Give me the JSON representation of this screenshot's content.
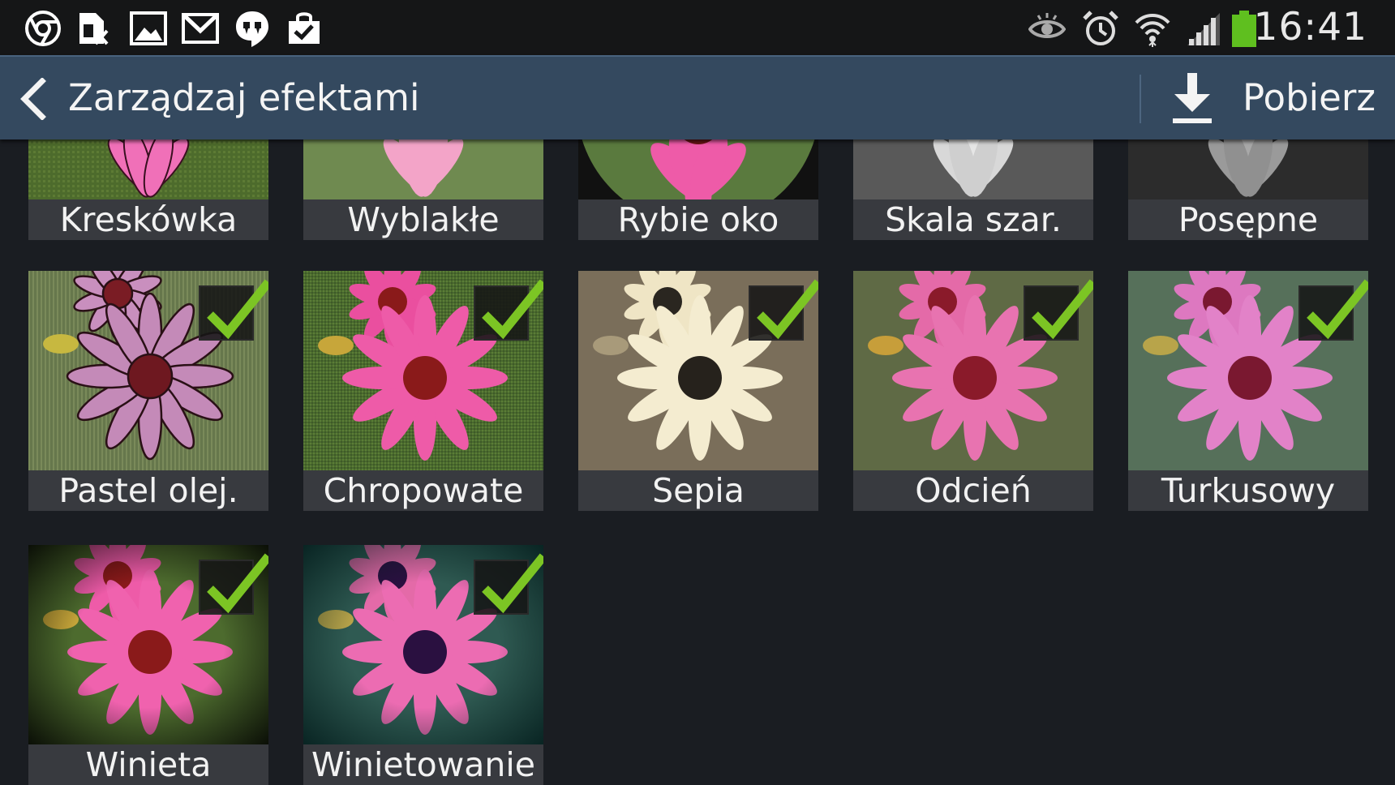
{
  "status_bar": {
    "time": "16:41",
    "left_icons": [
      "chrome-icon",
      "sim-card-icon",
      "gallery-icon",
      "gmail-icon",
      "hangouts-icon",
      "shopping-bag-icon"
    ],
    "right_icons": [
      "smart-stay-eye-icon",
      "alarm-icon",
      "wifi-icon",
      "signal-icon",
      "battery-icon"
    ],
    "battery_color": "#5fbf1f"
  },
  "action_bar": {
    "title": "Zarządzaj efektami",
    "download_label": "Pobierz",
    "background": "#34495f"
  },
  "effects": [
    {
      "label": "Kreskówka",
      "checked": false
    },
    {
      "label": "Wyblakłe",
      "checked": false
    },
    {
      "label": "Rybie oko",
      "checked": false
    },
    {
      "label": "Skala szar.",
      "checked": false
    },
    {
      "label": "Posępne",
      "checked": false
    },
    {
      "label": "Pastel olej.",
      "checked": true
    },
    {
      "label": "Chropowate",
      "checked": true
    },
    {
      "label": "Sepia",
      "checked": true
    },
    {
      "label": "Odcień",
      "checked": true
    },
    {
      "label": "Turkusowy",
      "checked": true
    },
    {
      "label": "Winieta",
      "checked": true
    },
    {
      "label": "Winietowanie",
      "checked": true
    }
  ],
  "colors": {
    "check_green": "#7cc524",
    "flower_pink": "#ee5ba8",
    "flower_center": "#8a1a1a"
  }
}
